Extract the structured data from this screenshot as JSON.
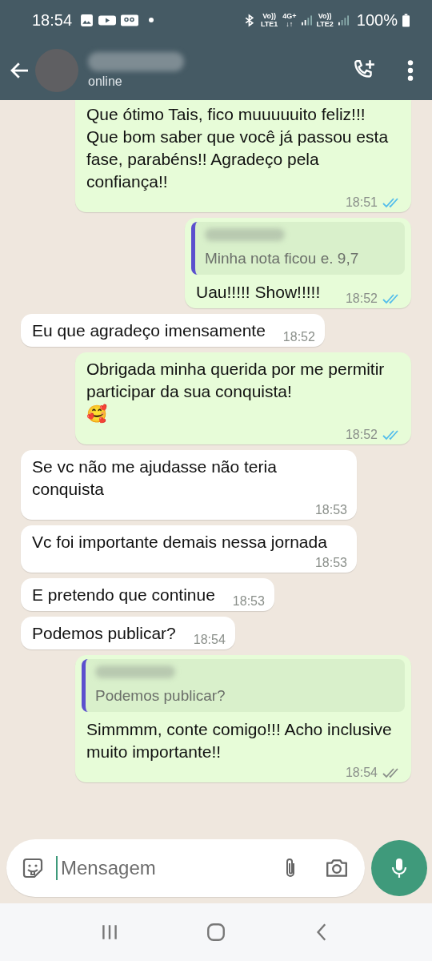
{
  "status_bar": {
    "time": "18:54",
    "network_labels": [
      {
        "top": "Vo))",
        "bottom": "LTE1"
      },
      {
        "top": "4G+",
        "bottom": "↓↑"
      },
      {
        "top": "Vo))",
        "bottom": "LTE2"
      }
    ],
    "battery": "100%"
  },
  "header": {
    "subtitle": "online"
  },
  "messages": [
    {
      "outgoing": true,
      "text": "Que ótimo Tais,  fico muuuuuito feliz!!! Que bom saber que você já passou esta fase, parabéns!! Agradeço pela confiança!!",
      "time": "18:51",
      "read": true
    },
    {
      "outgoing": true,
      "quote": "Minha nota ficou e. 9,7",
      "text": "Uau!!!!! Show!!!!!",
      "time": "18:52",
      "read": true
    },
    {
      "outgoing": false,
      "text": "Eu que agradeço imensamente",
      "time": "18:52"
    },
    {
      "outgoing": true,
      "text": "Obrigada minha querida por me permitir participar da sua conquista!\n🥰",
      "time": "18:52",
      "read": true
    },
    {
      "outgoing": false,
      "text": "Se vc não  me ajudasse não teria conquista",
      "time": "18:53"
    },
    {
      "outgoing": false,
      "text": "Vc foi importante demais nessa jornada",
      "time": "18:53"
    },
    {
      "outgoing": false,
      "text": "E pretendo que continue",
      "time": "18:53"
    },
    {
      "outgoing": false,
      "text": "Podemos publicar?",
      "time": "18:54"
    },
    {
      "outgoing": true,
      "quote": "Podemos publicar?",
      "text": "Simmmm, conte comigo!!! Acho inclusive muito importante!!",
      "time": "18:54",
      "read": false
    }
  ],
  "composer": {
    "placeholder": "Mensagem"
  }
}
